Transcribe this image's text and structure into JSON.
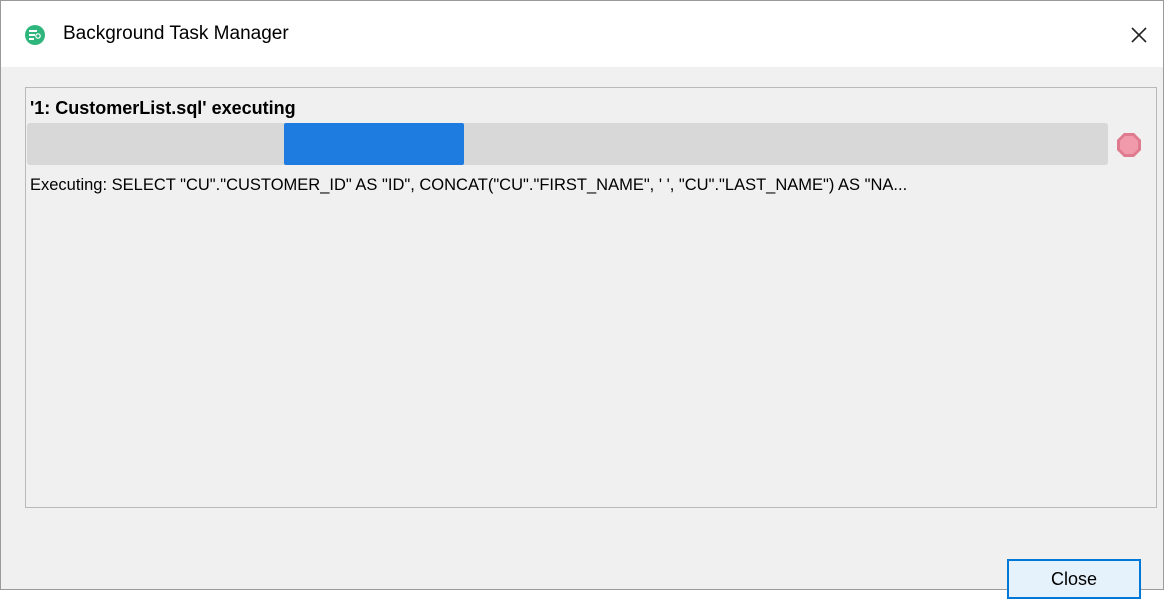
{
  "window": {
    "title": "Background Task Manager",
    "app_icon": "database-search-icon",
    "close_icon": "close-icon"
  },
  "task": {
    "heading": "'1: CustomerList.sql' executing",
    "progress": "indeterminate",
    "status": "Executing: SELECT \"CU\".\"CUSTOMER_ID\" AS \"ID\", CONCAT(\"CU\".\"FIRST_NAME\", ' ', \"CU\".\"LAST_NAME\") AS \"NA...",
    "stop_icon": "stop-icon"
  },
  "footer": {
    "close_label": "Close"
  },
  "colors": {
    "progress_fill": "#1e7be0",
    "progress_track": "#d8d8d8",
    "app_icon": "#2fb67c",
    "stop_icon": "#e07a8e",
    "button_border": "#0078d7"
  }
}
